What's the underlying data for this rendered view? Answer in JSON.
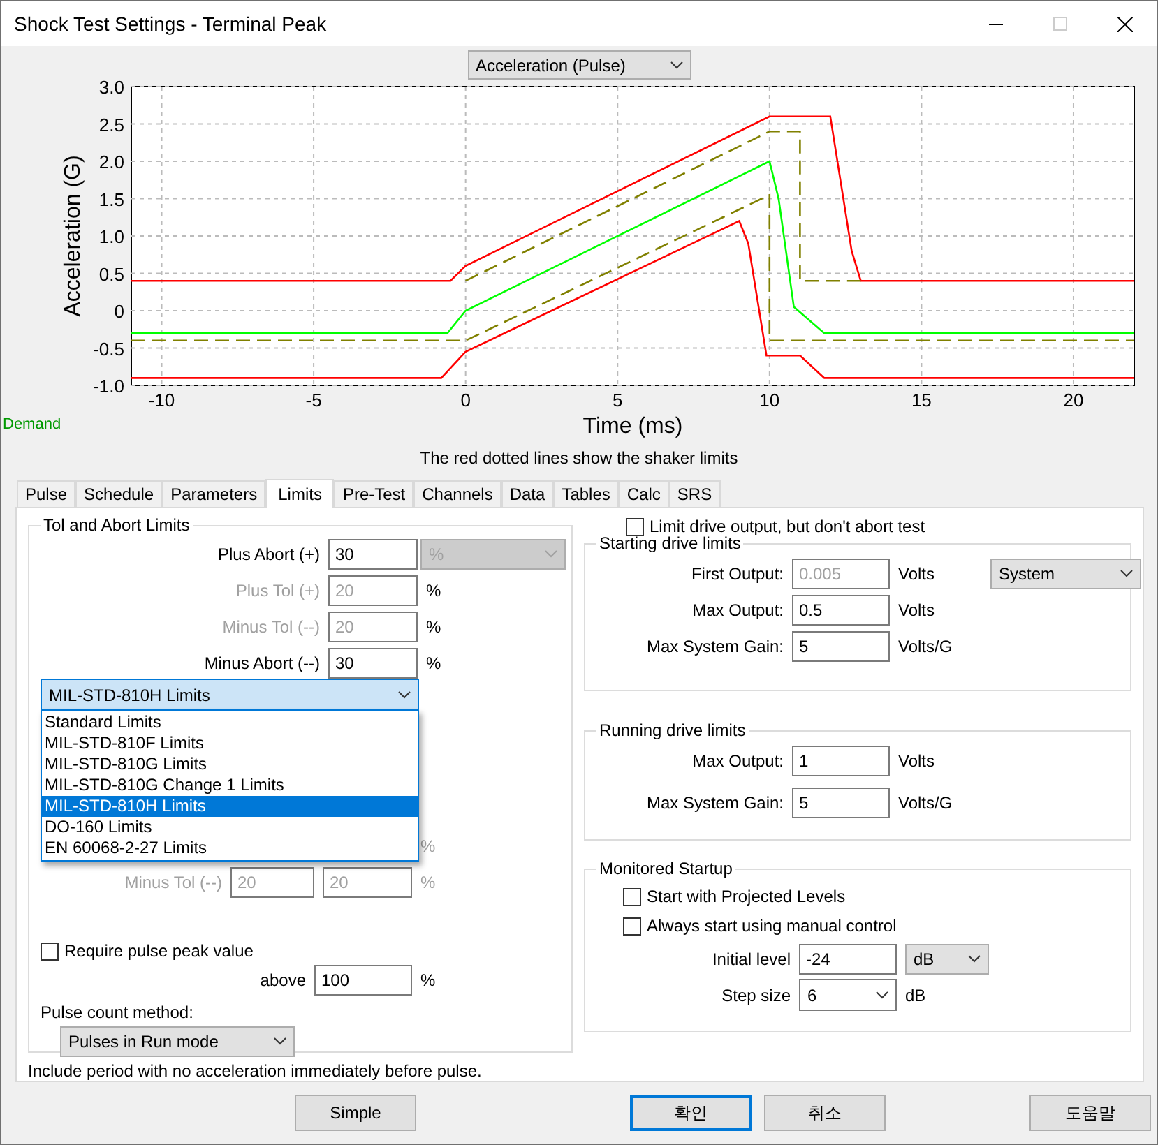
{
  "window": {
    "title": "Shock Test Settings - Terminal Peak"
  },
  "chart": {
    "selector": {
      "value": "Acceleration (Pulse)"
    },
    "chart_data": {
      "type": "line",
      "grid": true,
      "xlabel": "Time (ms)",
      "ylabel": "Acceleration (G)",
      "xlim": [
        -11,
        22
      ],
      "ylim": [
        -1,
        3
      ],
      "xticks": [
        -10,
        -5,
        0,
        5,
        10,
        15,
        20
      ],
      "yticks": [
        {
          "value": -1,
          "label": "-1.0"
        },
        {
          "value": -0.5,
          "label": "-0.5"
        },
        {
          "value": 0,
          "label": "0"
        },
        {
          "value": 0.5,
          "label": "0.5"
        },
        {
          "value": 1,
          "label": "1.0"
        },
        {
          "value": 1.5,
          "label": "1.5"
        },
        {
          "value": 2,
          "label": "2.0"
        },
        {
          "value": 2.5,
          "label": "2.5"
        },
        {
          "value": 3,
          "label": "3.0"
        }
      ],
      "series": [
        {
          "color": "#ff0000",
          "line_style": "solid",
          "x": [
            -11,
            -0.5,
            0,
            10,
            12,
            12.7,
            13,
            22
          ],
          "values": [
            0.4,
            0.4,
            0.6,
            2.6,
            2.6,
            0.8,
            0.4,
            0.4
          ]
        },
        {
          "color": "#808000",
          "line_style": "dashed",
          "x": [
            0,
            10,
            11,
            11,
            13
          ],
          "values": [
            0.4,
            2.4,
            2.4,
            0.4,
            0.4
          ]
        },
        {
          "name": "Demand",
          "color": "#00ff00",
          "line_style": "solid",
          "x": [
            -11,
            -0.6,
            0,
            10,
            10.3,
            10.8,
            11.8,
            22
          ],
          "values": [
            -0.3,
            -0.3,
            0,
            2,
            1.5,
            0.05,
            -0.3,
            -0.3
          ]
        },
        {
          "color": "#808000",
          "line_style": "dashed",
          "x": [
            -11,
            0,
            10,
            10,
            22
          ],
          "values": [
            -0.4,
            -0.4,
            1.55,
            -0.4,
            -0.4
          ]
        },
        {
          "color": "#ff0000",
          "line_style": "solid",
          "x": [
            -11,
            -0.8,
            0,
            9,
            9.3,
            9.9,
            11,
            11.8,
            22
          ],
          "values": [
            -0.9,
            -0.9,
            -0.55,
            1.2,
            0.9,
            -0.6,
            -0.6,
            -0.9,
            -0.9
          ]
        }
      ]
    },
    "caption": "The red dotted lines show the shaker limits"
  },
  "tabs": [
    {
      "label": "Pulse",
      "selected": false
    },
    {
      "label": "Schedule",
      "selected": false
    },
    {
      "label": "Parameters",
      "selected": false
    },
    {
      "label": "Limits",
      "selected": true
    },
    {
      "label": "Pre-Test",
      "selected": false
    },
    {
      "label": "Channels",
      "selected": false
    },
    {
      "label": "Data",
      "selected": false
    },
    {
      "label": "Tables",
      "selected": false
    },
    {
      "label": "Calc",
      "selected": false
    },
    {
      "label": "SRS",
      "selected": false
    }
  ],
  "tol_group": {
    "title": "Tol and Abort Limits",
    "rows": [
      {
        "label": "Plus Abort (+)",
        "value": "30",
        "unit_dropdown": {
          "value": "%",
          "disabled": true
        },
        "disabled": false
      },
      {
        "label": "Plus Tol (+)",
        "value": "20",
        "unit": "%",
        "disabled": true
      },
      {
        "label": "Minus Tol (--)",
        "value": "20",
        "unit": "%",
        "disabled": true
      },
      {
        "label": "Minus Abort (--)",
        "value": "30",
        "unit": "%",
        "disabled": false
      }
    ],
    "standard": {
      "value": "MIL-STD-810H Limits",
      "expanded": true,
      "options": [
        {
          "label": "Standard Limits",
          "selected": false
        },
        {
          "label": "MIL-STD-810F Limits",
          "selected": false
        },
        {
          "label": "MIL-STD-810G Limits",
          "selected": false
        },
        {
          "label": "MIL-STD-810G Change 1 Limits",
          "selected": false
        },
        {
          "label": "MIL-STD-810H Limits",
          "selected": true
        },
        {
          "label": "DO-160 Limits",
          "selected": false
        },
        {
          "label": "EN 60068-2-27 Limits",
          "selected": false
        }
      ]
    },
    "covered_unit": "%",
    "covered_row": {
      "label": "Minus Tol (--)",
      "value_1": "20",
      "value_2": "20",
      "unit": "%"
    },
    "require_peak": {
      "label": "Require pulse peak value",
      "checked": false
    },
    "above": {
      "label": "above",
      "value": "100",
      "unit": "%"
    },
    "pulse_count": {
      "label": "Pulse count method:",
      "value": "Pulses in Run mode"
    }
  },
  "limit_drive": {
    "label": "Limit drive output, but don't abort test",
    "checked": false
  },
  "starting_group": {
    "title": "Starting drive limits",
    "mode": "System",
    "rows": [
      {
        "label": "First Output:",
        "value": "0.005",
        "unit": "Volts",
        "disabled": true
      },
      {
        "label": "Max Output:",
        "value": "0.5",
        "unit": "Volts",
        "disabled": false
      },
      {
        "label": "Max System Gain:",
        "value": "5",
        "unit": "Volts/G",
        "disabled": false
      }
    ]
  },
  "running_group": {
    "title": "Running drive limits",
    "rows": [
      {
        "label": "Max Output:",
        "value": "1",
        "unit": "Volts",
        "disabled": false
      },
      {
        "label": "Max System Gain:",
        "value": "5",
        "unit": "Volts/G",
        "disabled": false
      }
    ]
  },
  "monitored_group": {
    "title": "Monitored Startup",
    "checks": [
      {
        "label": "Start with Projected Levels",
        "checked": false
      },
      {
        "label": "Always start using manual control",
        "checked": false
      }
    ],
    "initial_level": {
      "label": "Initial level",
      "value": "-24",
      "unit": "dB"
    },
    "step_size": {
      "label": "Step size",
      "value": "6",
      "unit": "dB"
    }
  },
  "footnote": "Include period with no acceleration immediately before pulse.",
  "buttons": [
    {
      "label": "Simple",
      "default": false
    },
    {
      "label": "확인",
      "default": true
    },
    {
      "label": "취소",
      "default": false
    },
    {
      "label": "도움말",
      "default": false
    }
  ]
}
